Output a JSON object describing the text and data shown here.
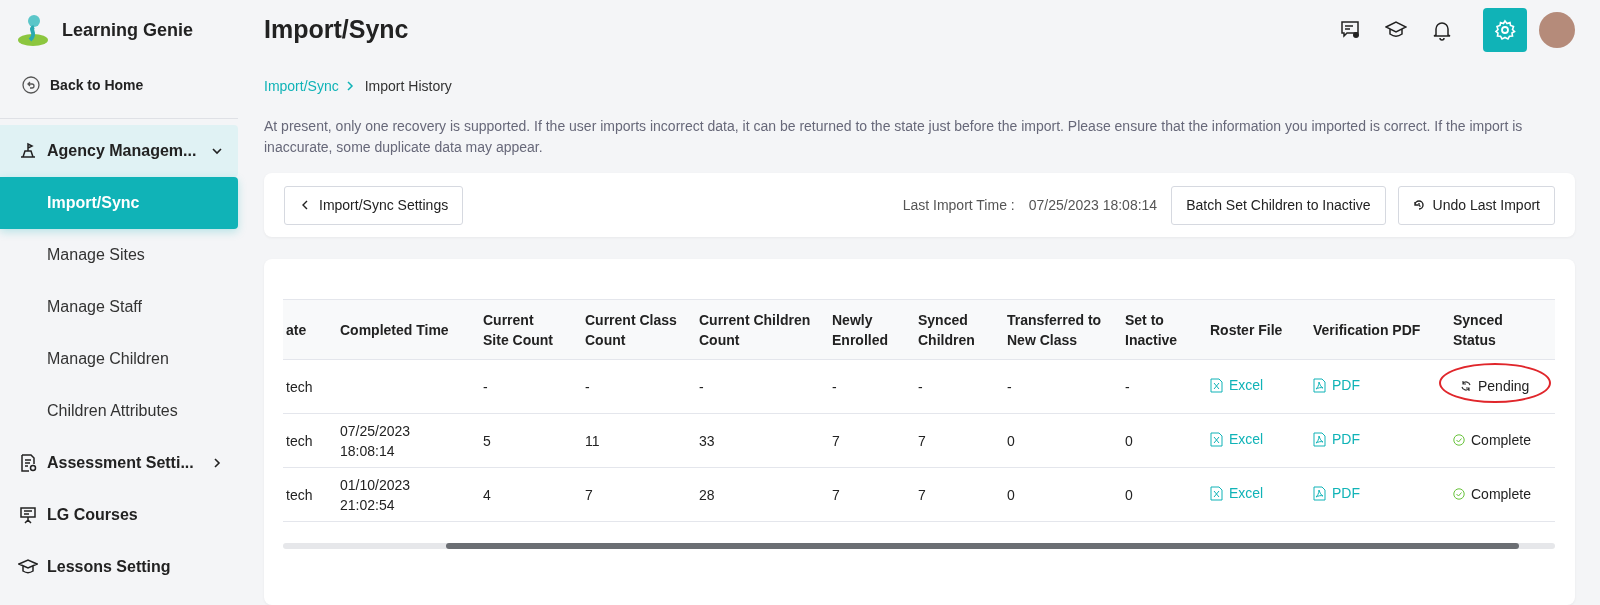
{
  "sidebar": {
    "app_name": "Learning Genie",
    "back_link": "Back to Home",
    "items": [
      {
        "kind": "group",
        "label": "Agency Managem...",
        "expanded": true,
        "children": [
          {
            "label": "Import/Sync",
            "selected": true
          },
          {
            "label": "Manage Sites",
            "selected": false
          },
          {
            "label": "Manage Staff",
            "selected": false
          },
          {
            "label": "Manage Children",
            "selected": false
          },
          {
            "label": "Children Attributes",
            "selected": false
          }
        ]
      },
      {
        "kind": "group",
        "label": "Assessment Setti...",
        "expanded": false
      },
      {
        "kind": "link",
        "label": "LG Courses"
      },
      {
        "kind": "link",
        "label": "Lessons Setting"
      }
    ]
  },
  "header": {
    "title": "Import/Sync"
  },
  "breadcrumb": [
    {
      "label": "Import/Sync",
      "link": true
    },
    {
      "label": "Import History",
      "link": false
    }
  ],
  "notice": "At present, only one recovery is supported. If the user imports incorrect data, it can be returned to the state just before the import. Please ensure that the information you imported is correct. If the import is inaccurate, some duplicate data may appear.",
  "toolbar": {
    "back_button": "Import/Sync Settings",
    "last_import_label": "Last Import Time :",
    "last_import_value": "07/25/2023 18:08:14",
    "batch_button": "Batch Set Children to Inactive",
    "undo_button": "Undo Last Import"
  },
  "table": {
    "columns": [
      "ate",
      "Completed Time",
      "Current Site Count",
      "Current Class Count",
      "Current Children Count",
      "Newly Enrolled",
      "Synced Children",
      "Transferred to New Class",
      "Set to Inactive",
      "Roster File",
      "Verification PDF",
      "Synced Status"
    ],
    "rows": [
      {
        "cells": [
          "tech",
          "",
          "-",
          "-",
          "-",
          "-",
          "-",
          "-",
          "-"
        ],
        "roster": "Excel",
        "pdf": "PDF",
        "status": {
          "kind": "pending",
          "label": "Pending",
          "circled": true
        }
      },
      {
        "cells": [
          "tech",
          "07/25/2023 18:08:14",
          "5",
          "11",
          "33",
          "7",
          "7",
          "0",
          "0"
        ],
        "roster": "Excel",
        "pdf": "PDF",
        "status": {
          "kind": "complete",
          "label": "Complete",
          "circled": false
        }
      },
      {
        "cells": [
          "tech",
          "01/10/2023 21:02:54",
          "4",
          "7",
          "28",
          "7",
          "7",
          "0",
          "0"
        ],
        "roster": "Excel",
        "pdf": "PDF",
        "status": {
          "kind": "complete",
          "label": "Complete",
          "circled": false
        }
      }
    ]
  }
}
